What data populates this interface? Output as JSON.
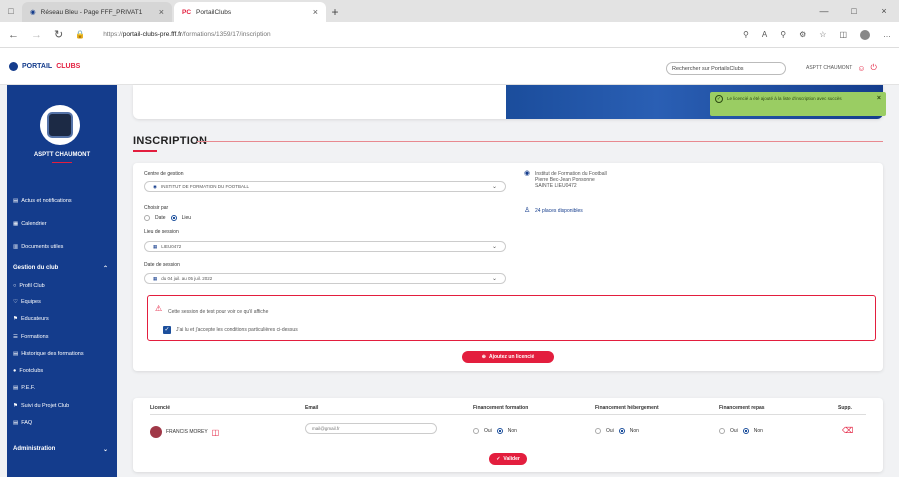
{
  "browser": {
    "tabs": [
      {
        "title": "Réseau Bleu - Page FFF_PRIVAT1",
        "active": false
      },
      {
        "title": "PortailClubs",
        "active": true
      }
    ],
    "url_prefix": "https://",
    "url_host": "portail-clubs-pre.fff.fr",
    "url_path": "/formations/1359/17/inscription"
  },
  "header": {
    "logo_text_a": "PORTAIL",
    "logo_text_b": "CLUBS",
    "search_label": "Rechercher sur PortailsClubs",
    "account_label": "ASPTT CHAUMONT"
  },
  "sidebar": {
    "club_name": "ASPTT CHAUMONT",
    "items": [
      {
        "label": "Actus et notifications",
        "icon": "▤"
      },
      {
        "label": "Calendrier",
        "icon": "▦"
      },
      {
        "label": "Documents utiles",
        "icon": "▥"
      },
      {
        "label": "Gestion du club",
        "icon": ""
      },
      {
        "label": "Profil Club",
        "icon": "○"
      },
      {
        "label": "Equipes",
        "icon": "♡"
      },
      {
        "label": "Educateurs",
        "icon": "⚑"
      },
      {
        "label": "Formations",
        "icon": "☰"
      },
      {
        "label": "Historique des formations",
        "icon": "▤"
      },
      {
        "label": "Footclubs",
        "icon": "●"
      },
      {
        "label": "P.E.F.",
        "icon": "▤"
      },
      {
        "label": "Suivi du Projet Club",
        "icon": "⚑"
      },
      {
        "label": "FAQ",
        "icon": "▤"
      },
      {
        "label": "Administration",
        "icon": ""
      }
    ]
  },
  "toast": {
    "message": "Le licencié a été ajouté à la liste d'inscription avec succès"
  },
  "section_title": "INSCRIPTION",
  "form": {
    "centre_label": "Centre de gestion",
    "centre_value": "INSTITUT DE FORMATION DU FOOTBALL",
    "choisir_label": "Choisir par",
    "choice_a": "Date",
    "choice_b": "Lieu",
    "lieu_label": "Lieu de session",
    "lieu_value": "LIEU0472",
    "date_label": "Date de session",
    "date_value": "du 04 juil. au 05 juil. 2022",
    "address_line1": "Institut de Formation du Football",
    "address_line2": "Pierre Bec-Jean Ponsonne",
    "address_line3": "SAINTE LIEU0472",
    "places": "24 places disponibles",
    "warning_text": "Cette session de test pour voir ce qu'il affiche",
    "checkbox_label": "J'ai lu et j'accepte les conditions particulières ci-dessus",
    "add_button": "Ajoutez un licencié"
  },
  "table": {
    "headers": [
      "Licencié",
      "Email",
      "Financement formation",
      "Financement hébergement",
      "Financement repas",
      "Supp."
    ],
    "row": {
      "name": "FRANCIS MOREY",
      "email": "mail@gmail.fr",
      "oui": "Oui",
      "non": "Non"
    },
    "validate_button": "Valider"
  }
}
